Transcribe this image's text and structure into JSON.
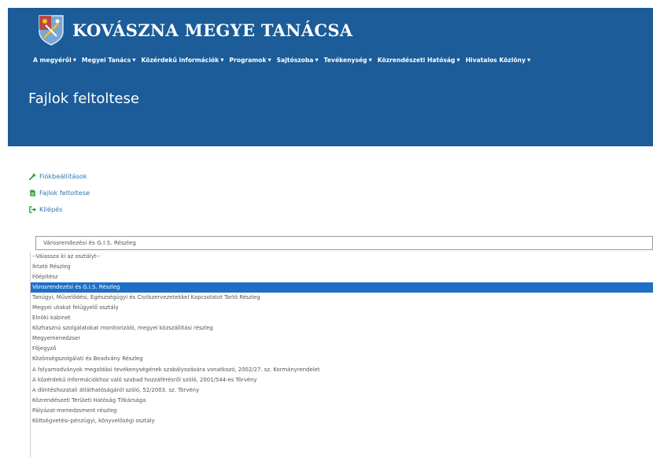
{
  "header": {
    "site_title": "KOVÁSZNA MEGYE TANÁCSA",
    "page_heading": "Fajlok feltoltese",
    "brand_color": "#1b5c99"
  },
  "nav": {
    "items": [
      {
        "label": "A megyéről"
      },
      {
        "label": "Megyei Tanács"
      },
      {
        "label": "Közérdekű információk"
      },
      {
        "label": "Programok"
      },
      {
        "label": "Sajtószoba"
      },
      {
        "label": "Tevékenység"
      },
      {
        "label": "Közrendészeti Hatóság"
      },
      {
        "label": "Hivatalos Közlöny"
      }
    ]
  },
  "side_links": [
    {
      "label": "Fiókbeállítások",
      "icon": "wrench-icon",
      "color": "#2e9d3a"
    },
    {
      "label": "Fajlok feltoltese",
      "icon": "file-icon",
      "color": "#2e9d3a"
    },
    {
      "label": "Kilépés",
      "icon": "sign-out-icon",
      "color": "#2e9d3a"
    }
  ],
  "department_select": {
    "selected_value": "Városrendezési és G.I.S. Részleg",
    "highlight_color": "#1e6fc6",
    "options": [
      "--Válassza ki az osztályt--",
      "Iktató Részleg",
      "Főépítész",
      "Városrendezési és G.I.S. Részleg",
      "Tanügyi, Művelődési, Egészségügyi és Civilszervezetekkel Kapcsolatot Tartó Részleg",
      "Megyei utakat felügyelő osztály",
      "Elnöki kabinet",
      "Közhasznú szolgálatokat monitorizáló, megyei közszállítási részleg",
      "Megyemenedzser",
      "Főjegyző",
      "Közönségszolgálati és Beadvány Részleg",
      "A folyamodványok megoldási tevékenységének szabályozására vonatkozó, 2002/27. sz. Kormányrendelet",
      "A közérdekű információkhoz való szabad hozzáférésről szóló, 2001/544-es Törvény",
      "A döntéshozatali átláthatóságáról szóló, 52/2003. sz. Törvény",
      "Közrendészeti Területi Hatóság Titkársága",
      "Pályázat-menedzsment részleg",
      "Költségvetési-pénzügyi, könyvelőségi osztály"
    ]
  }
}
